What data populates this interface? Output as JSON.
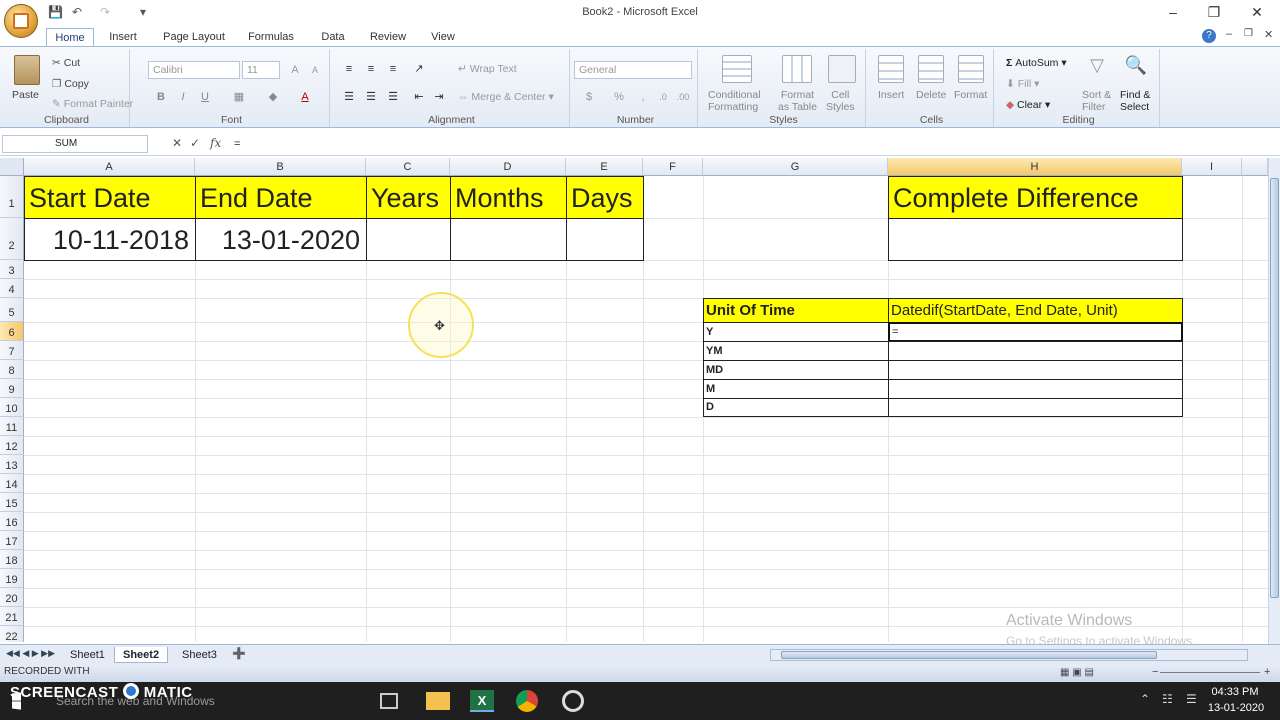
{
  "window": {
    "title": "Book2 - Microsoft Excel"
  },
  "ribbon": {
    "tabs": [
      "Home",
      "Insert",
      "Page Layout",
      "Formulas",
      "Data",
      "Review",
      "View"
    ],
    "clipboard": {
      "paste": "Paste",
      "cut": "Cut",
      "copy": "Copy",
      "format_painter": "Format Painter",
      "label": "Clipboard"
    },
    "font": {
      "name": "Calibri",
      "size": "11",
      "label": "Font"
    },
    "alignment": {
      "wrap_text": "Wrap Text",
      "merge_center": "Merge & Center",
      "label": "Alignment"
    },
    "number": {
      "format": "General",
      "label": "Number"
    },
    "styles": {
      "conditional_formatting_1": "Conditional",
      "conditional_formatting_2": "Formatting",
      "format_table_1": "Format",
      "format_table_2": "as Table",
      "cell_styles_1": "Cell",
      "cell_styles_2": "Styles",
      "label": "Styles"
    },
    "cells": {
      "insert": "Insert",
      "delete": "Delete",
      "format": "Format",
      "label": "Cells"
    },
    "editing": {
      "autosum": "AutoSum",
      "fill": "Fill",
      "clear": "Clear",
      "sort_filter_1": "Sort &",
      "sort_filter_2": "Filter",
      "find_select_1": "Find &",
      "find_select_2": "Select",
      "label": "Editing"
    }
  },
  "formula_bar": {
    "name_box": "SUM",
    "formula": "="
  },
  "grid": {
    "columns": [
      "A",
      "B",
      "C",
      "D",
      "E",
      "F",
      "G",
      "H",
      "I"
    ],
    "rows": [
      "1",
      "2",
      "3",
      "4",
      "5",
      "6",
      "7",
      "8",
      "9",
      "10",
      "11",
      "12",
      "13",
      "14",
      "15",
      "16",
      "17",
      "18",
      "19",
      "20",
      "21",
      "22"
    ],
    "header_row": {
      "start_date": "Start Date",
      "end_date": "End Date",
      "years": "Years",
      "months": "Months",
      "days": "Days",
      "complete_difference": "Complete Difference"
    },
    "data_row": {
      "start_date": "10-11-2018",
      "end_date": "13-01-2020"
    },
    "unit_table": {
      "header_unit": "Unit Of Time",
      "header_formula": "Datedif(StartDate, End Date, Unit)",
      "units": [
        "Y",
        "YM",
        "MD",
        "M",
        "D"
      ],
      "editing_value": "="
    }
  },
  "sheets": [
    "Sheet1",
    "Sheet2",
    "Sheet3"
  ],
  "active_sheet": "Sheet2",
  "activation": {
    "line1": "Activate Windows",
    "line2": "Go to Settings to activate Windows."
  },
  "taskbar": {
    "search_placeholder": "Search the web and Windows",
    "time": "04:33 PM",
    "date": "13-01-2020"
  },
  "recorder": {
    "recorded_with": "RECORDED WITH",
    "brand": "SCREENCAST",
    "brand2": "MATIC"
  },
  "colors": {
    "header_fill": "#ffff00",
    "selected_header": "#f5c76a",
    "ribbon_bg": "#e4ebf5"
  }
}
